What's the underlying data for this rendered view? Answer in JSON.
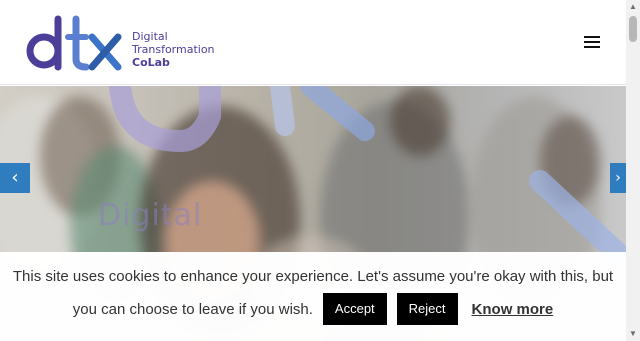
{
  "header": {
    "logo": {
      "mark_text": "dtx",
      "line1": "Digital",
      "line2": "Transformation",
      "line3": "CoLab"
    },
    "menu_icon": "hamburger-icon"
  },
  "hero": {
    "word": "Digital",
    "prev_icon": "chevron-left-icon",
    "next_icon": "chevron-right-icon",
    "prev_glyph": "‹",
    "next_glyph": "›"
  },
  "cookie": {
    "message_line1": "This site uses cookies to enhance your experience. Let's assume you're okay with this, but",
    "message_line2": "you can choose to leave if you wish.",
    "accept_label": "Accept",
    "reject_label": "Reject",
    "know_more_label": "Know more"
  },
  "colors": {
    "brand_purple": "#4c3f9a",
    "brand_blue": "#5b8fd0",
    "slider_arrow": "#2f7dbf",
    "button_bg": "#000000"
  }
}
